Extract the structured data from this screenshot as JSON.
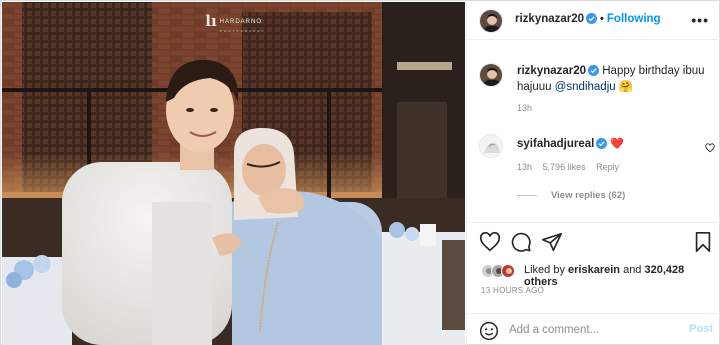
{
  "photo": {
    "watermark_mark": "lı",
    "watermark_text": "HARDARNO",
    "watermark_sub": "PHOTOGRAPHY",
    "colors": {
      "wall": "#6e3b26",
      "shirt_left": "#eae9e6",
      "hijab": "#ece3dc",
      "dress": "#b9cbe3"
    }
  },
  "header": {
    "username": "rizkynazar20",
    "separator": "•",
    "follow_label": "Following",
    "more_label": "•••"
  },
  "caption": {
    "username": "rizkynazar20",
    "text": "Happy birthday ibuu hajuuu ",
    "mention": "@sndihadju",
    "emoji": "🤗",
    "time": "13h"
  },
  "comment": {
    "username": "syifahadjureal",
    "text": "❤️",
    "time": "13h",
    "likes": "5,796 likes",
    "reply_label": "Reply",
    "view_replies": "View replies (62)"
  },
  "likes": {
    "prefix": "Liked by ",
    "user": "eriskarein",
    "middle": " and ",
    "count": "320,428 others"
  },
  "post_time": "13 HOURS AGO",
  "comment_box": {
    "placeholder": "Add a comment...",
    "post_label": "Post"
  },
  "colors": {
    "accent": "#0095f6",
    "verified": "#3897f0",
    "heart": "#ed4956",
    "muted": "#8e8e8e"
  }
}
